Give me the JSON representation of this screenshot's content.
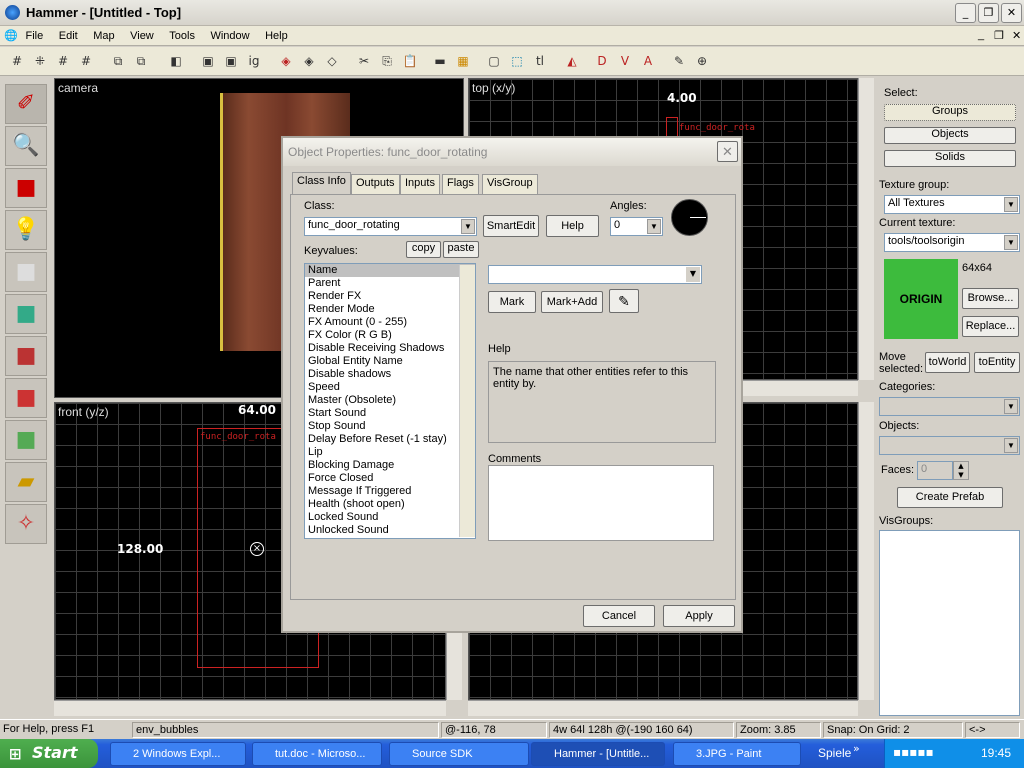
{
  "app": {
    "title": "Hammer - [Untitled - Top]"
  },
  "menu": [
    "File",
    "Edit",
    "Map",
    "View",
    "Tools",
    "Window",
    "Help"
  ],
  "viewports": {
    "camera": "camera",
    "top": "top (x/y)",
    "front": "front (y/z)",
    "top_measure": "4.00",
    "front_measure_top": "64.00",
    "front_measure_left": "128.00",
    "entity_label": "func_door_rota"
  },
  "dialog": {
    "title": "Object Properties: func_door_rotating",
    "tabs": [
      "Class Info",
      "Outputs",
      "Inputs",
      "Flags",
      "VisGroup"
    ],
    "class_label": "Class:",
    "class_value": "func_door_rotating",
    "smartedit": "SmartEdit",
    "help_btn": "Help",
    "angles_label": "Angles:",
    "angles_value": "0",
    "keyvalues_label": "Keyvalues:",
    "copy": "copy",
    "paste": "paste",
    "keyvalues": [
      "Name",
      "Parent",
      "Render FX",
      "Render Mode",
      "FX Amount (0 - 255)",
      "FX Color (R G B)",
      "Disable Receiving Shadows",
      "Global Entity Name",
      "Disable shadows",
      "Speed",
      "Master (Obsolete)",
      "Start Sound",
      "Stop Sound",
      "Delay Before Reset (-1 stay)",
      "Lip",
      "Blocking Damage",
      "Force Closed",
      "Message If Triggered",
      "Health (shoot open)",
      "Locked Sound",
      "Unlocked Sound"
    ],
    "value_input": "",
    "mark": "Mark",
    "mark_add": "Mark+Add",
    "help_label": "Help",
    "help_text": "The name that other entities refer to this entity by.",
    "comments_label": "Comments",
    "cancel": "Cancel",
    "apply": "Apply"
  },
  "right": {
    "select_label": "Select:",
    "groups": "Groups",
    "objects": "Objects",
    "solids": "Solids",
    "texture_group_label": "Texture group:",
    "texture_group": "All Textures",
    "current_texture_label": "Current texture:",
    "current_texture": "tools/toolsorigin",
    "texture_size": "64x64",
    "texture_name": "ORIGIN",
    "browse": "Browse...",
    "replace": "Replace...",
    "move_selected": "Move selected:",
    "to_world": "toWorld",
    "to_entity": "toEntity",
    "categories_label": "Categories:",
    "objects_label": "Objects:",
    "faces_label": "Faces:",
    "faces_value": "0",
    "create_prefab": "Create Prefab",
    "visgroups_label": "VisGroups:"
  },
  "status": {
    "help": "For Help, press F1",
    "entity": "env_bubbles",
    "coords": "@-116, 78",
    "size": "4w 64l 128h @(-190 160 64)",
    "zoom": "Zoom: 3.85",
    "snap": "Snap: On Grid: 2",
    "nav": "<->"
  },
  "taskbar": {
    "start": "Start",
    "tasks": [
      "2 Windows Expl...",
      "tut.doc - Microso...",
      "Source SDK",
      "Hammer - [Untitle...",
      "3.JPG - Paint"
    ],
    "spiele": "Spiele",
    "clock": "19:45"
  },
  "colors": {
    "texture_green": "#3dbb3d",
    "taskbar_blue": "#245edb",
    "start_green": "#3b943b",
    "door_brown": "#7a3c28"
  }
}
